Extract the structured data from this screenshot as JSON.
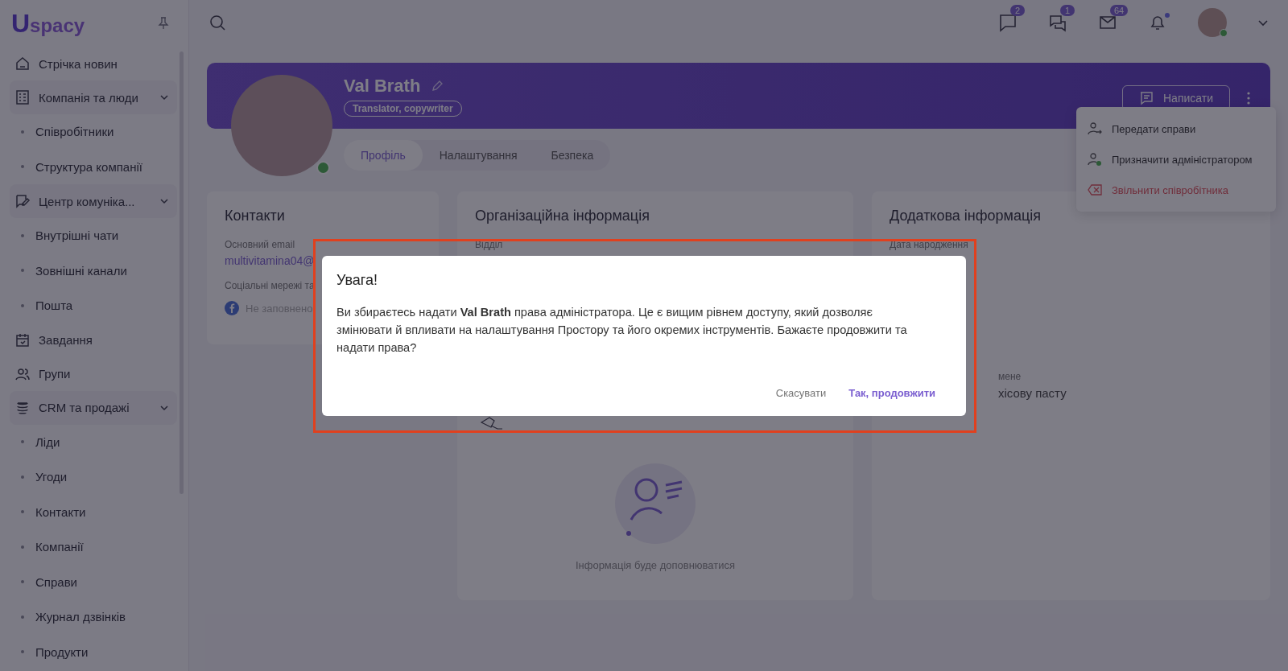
{
  "sidebar": {
    "logo": {
      "mark": "U",
      "text": "spacy"
    },
    "items": [
      {
        "label": "Стрічка новин"
      },
      {
        "label": "Компанія та люди",
        "expanded": true,
        "children": [
          {
            "label": "Співробітники"
          },
          {
            "label": "Структура компанії"
          }
        ]
      },
      {
        "label": "Центр комуніка...",
        "expanded": true,
        "children": [
          {
            "label": "Внутрішні чати"
          },
          {
            "label": "Зовнішні канали"
          },
          {
            "label": "Пошта"
          }
        ]
      },
      {
        "label": "Завдання"
      },
      {
        "label": "Групи"
      },
      {
        "label": "CRM та продажі",
        "expanded": true,
        "children": [
          {
            "label": "Ліди"
          },
          {
            "label": "Угоди"
          },
          {
            "label": "Контакти"
          },
          {
            "label": "Компанії"
          },
          {
            "label": "Справи"
          },
          {
            "label": "Журнал дзвінків"
          },
          {
            "label": "Продукти"
          }
        ]
      }
    ]
  },
  "topbar": {
    "badges": [
      {
        "count": "2"
      },
      {
        "count": "1"
      },
      {
        "count": "64"
      }
    ],
    "bell_unread": true,
    "user_online": true
  },
  "profile": {
    "name": "Val Brath",
    "role": "Translator, copywriter",
    "online": true,
    "write_button": "Написати",
    "tabs": [
      {
        "label": "Профіль",
        "selected": true
      },
      {
        "label": "Налаштування",
        "selected": false
      },
      {
        "label": "Безпека",
        "selected": false
      }
    ]
  },
  "menu": {
    "items": [
      {
        "label": "Передати справи",
        "kind": "transfer"
      },
      {
        "label": "Призначити адміністратором",
        "kind": "admin"
      },
      {
        "label": "Звільнити співробітника",
        "kind": "danger"
      }
    ]
  },
  "contacts": {
    "title": "Контакти",
    "email_label": "Основний email",
    "email": "multivitamina04@",
    "social_label": "Соціальні мережі та",
    "social_value": "Не заповнено"
  },
  "org": {
    "title": "Організаційна інформація",
    "department_label": "Відділ",
    "empty_text": "Інформація буде доповнюватися"
  },
  "extra": {
    "title": "Додаткова інформація",
    "birthday_label": "Дата народження",
    "field_label": "мене",
    "field_value": "хісову пасту"
  },
  "dialog": {
    "title": "Увага!",
    "body": "Ви збираєтесь надати **Val Brath** права адміністратора. Це є вищим рівнем доступу, який дозволяє змінювати й впливати на налаштування Простору та його окремих інструментів. Бажаєте продовжити та надати права?",
    "cancel": "Скасувати",
    "confirm": "Так, продовжити"
  }
}
